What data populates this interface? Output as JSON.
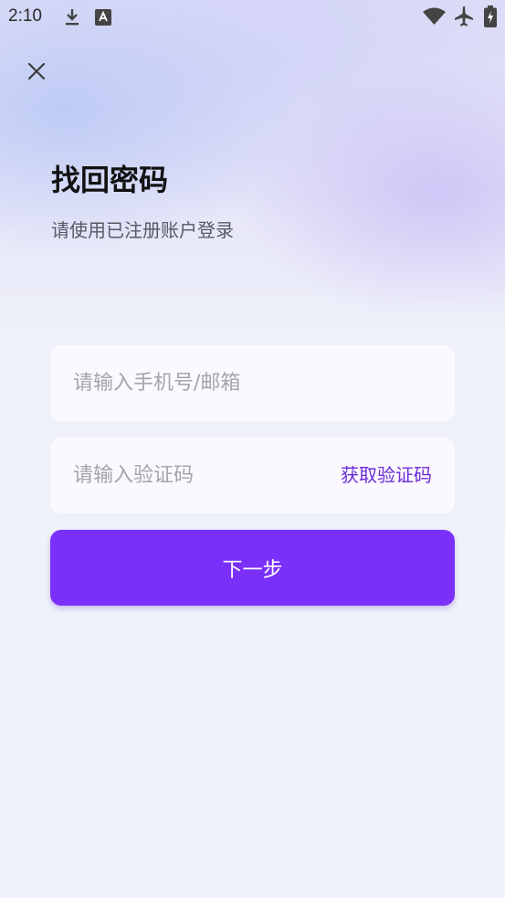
{
  "status_bar": {
    "time": "2:10",
    "icons": [
      "download-icon",
      "font-app-icon",
      "wifi-icon",
      "airplane-mode-icon",
      "battery-charging-icon"
    ]
  },
  "header": {
    "close_icon": "close-icon"
  },
  "main": {
    "title": "找回密码",
    "subtitle": "请使用已注册账户登录",
    "phone_input": {
      "placeholder": "请输入手机号/邮箱",
      "value": ""
    },
    "code_input": {
      "placeholder": "请输入验证码",
      "value": ""
    },
    "get_code_label": "获取验证码",
    "next_button_label": "下一步"
  },
  "colors": {
    "accent": "#7a30f9",
    "link": "#6a2cd8",
    "field_bg": "#fbf8fe"
  }
}
